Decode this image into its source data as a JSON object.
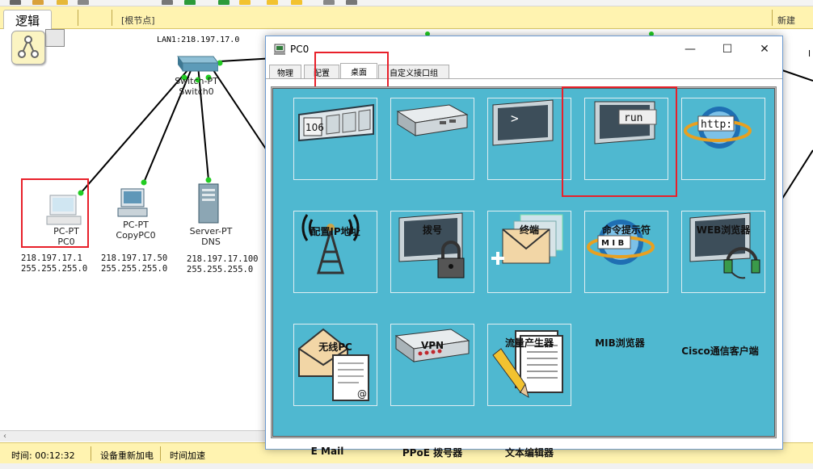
{
  "workspace": {
    "logic_tab": "逻辑",
    "root_node": "[根节点]",
    "new_label": "新建",
    "lan_label": "LAN1:218.197.17.0",
    "switch": {
      "line1": "Switch-PT",
      "line2": "Switch0"
    },
    "devices": [
      {
        "type": "PC-PT",
        "name": "PC0",
        "ip": "218.197.17.1",
        "mask": "255.255.255.0"
      },
      {
        "type": "PC-PT",
        "name": "CopyPC0",
        "ip": "218.197.17.50",
        "mask": "255.255.255.0"
      },
      {
        "type": "Server-PT",
        "name": "DNS",
        "ip": "218.197.17.100",
        "mask": "255.255.255.0"
      }
    ],
    "right_edge_letter": "l"
  },
  "status_bar": {
    "time": "时间: 00:12:32",
    "power": "设备重新加电",
    "fast": "时间加速"
  },
  "window": {
    "title": "PC0",
    "minimize": "—",
    "maximize": "☐",
    "close": "✕",
    "tabs": [
      "物理",
      "配置",
      "桌面",
      "自定义接口组"
    ],
    "active_tab": "桌面"
  },
  "apps": [
    {
      "label": "配置IP地址",
      "icon": "ip-config-icon"
    },
    {
      "label": "拨号",
      "icon": "dialup-icon"
    },
    {
      "label": "终端",
      "icon": "terminal-icon"
    },
    {
      "label": "命令提示符",
      "icon": "command-prompt-icon"
    },
    {
      "label": "WEB浏览器",
      "icon": "web-browser-icon"
    },
    {
      "label": "无线PC",
      "icon": "wireless-icon"
    },
    {
      "label": "VPN",
      "icon": "vpn-icon"
    },
    {
      "label": "流量产生器",
      "icon": "traffic-generator-icon"
    },
    {
      "label": "MIB浏览器",
      "icon": "mib-browser-icon"
    },
    {
      "label": "Cisco通信客户端",
      "icon": "cisco-communicator-icon"
    },
    {
      "label": "E Mail",
      "icon": "email-icon"
    },
    {
      "label": "PPoE 拨号器",
      "icon": "pppoe-dialer-icon"
    },
    {
      "label": "文本编辑器",
      "icon": "text-editor-icon"
    }
  ],
  "icon_text": {
    "ip_number": "106",
    "terminal_prompt": ">",
    "run": "run",
    "http": "http:",
    "mib": "M I B"
  },
  "colors": {
    "desktop_bg": "#4fb8d0",
    "highlight": "#e8202a",
    "toolbar_bg": "#fff3b0",
    "link": "#000000",
    "port": "#22cc22"
  }
}
